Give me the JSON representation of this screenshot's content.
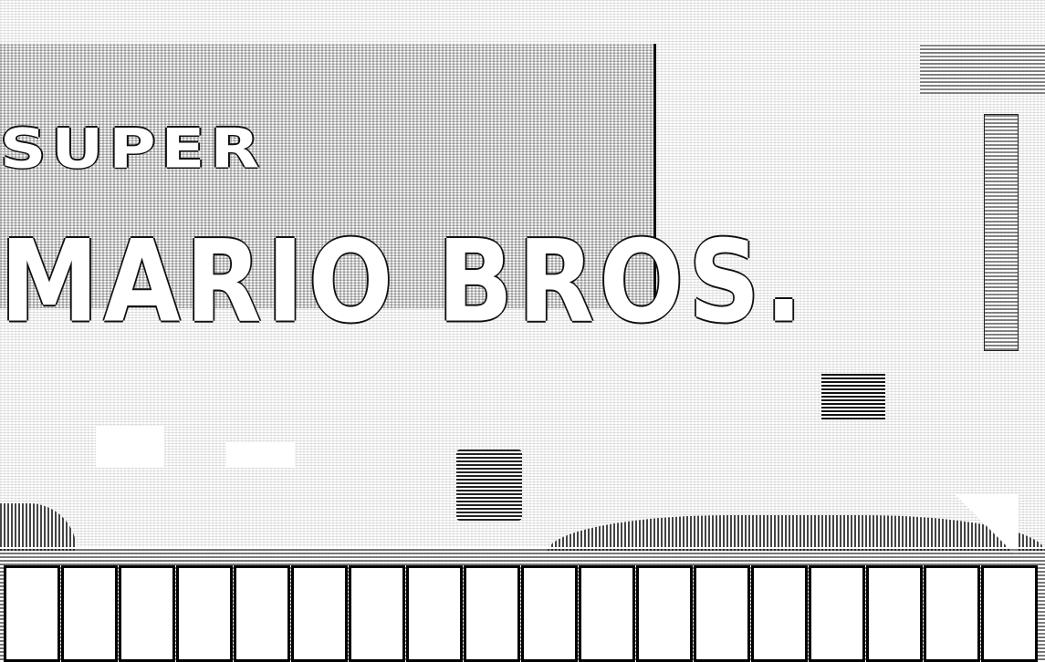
{
  "logo": {
    "line1": "SUPER",
    "line2": "MARIO BROS."
  },
  "icons": {
    "hero": "mario-sprite-icon",
    "pipe": "pipe-icon",
    "brick": "brick-block-icon"
  }
}
